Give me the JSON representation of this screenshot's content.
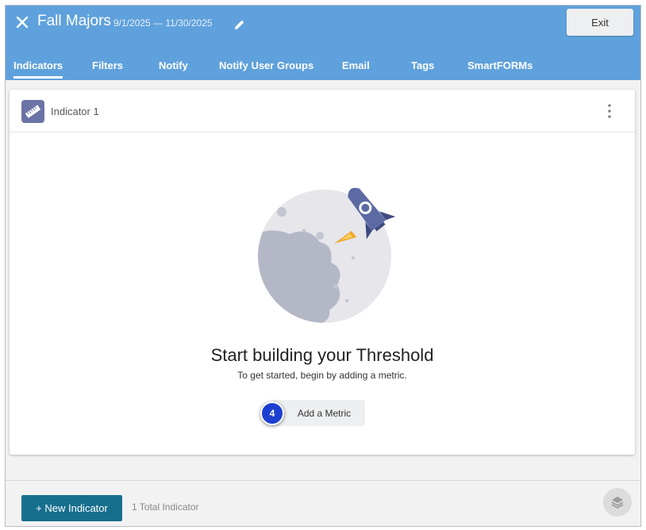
{
  "header": {
    "title": "Fall Majors",
    "date_range": "9/1/2025 — 11/30/2025",
    "exit_label": "Exit",
    "close_icon": "close-icon",
    "edit_icon": "pencil-icon"
  },
  "tabs": [
    {
      "label": "Indicators",
      "active": true
    },
    {
      "label": "Filters",
      "active": false
    },
    {
      "label": "Notify",
      "active": false
    },
    {
      "label": "Notify User Groups",
      "active": false
    },
    {
      "label": "Email",
      "active": false
    },
    {
      "label": "Tags",
      "active": false
    },
    {
      "label": "SmartFORMs",
      "active": false
    }
  ],
  "indicator_card": {
    "name": "Indicator 1",
    "icon": "ruler-icon",
    "menu_icon": "kebab-menu-icon",
    "empty_state": {
      "title": "Start building your Threshold",
      "subtitle": "To get started, begin by adding a metric.",
      "button_label": "Add a Metric",
      "step_badge": "4"
    }
  },
  "footer": {
    "new_button_label": "+ New Indicator",
    "total_label": "1 Total Indicator",
    "layers_icon": "layers-icon"
  },
  "colors": {
    "header_bg": "#5fa1dc",
    "primary_button": "#176f8e",
    "indicator_icon_bg": "#6b73a6",
    "step_badge_bg": "#1d3fd1"
  }
}
